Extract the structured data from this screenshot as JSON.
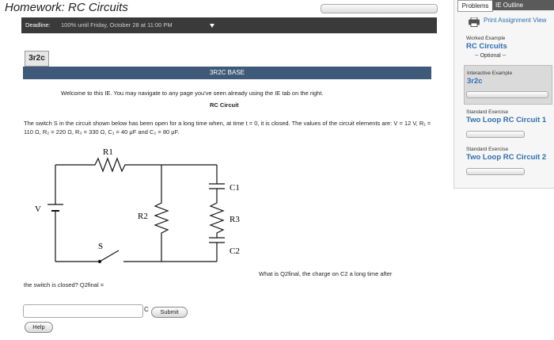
{
  "header": {
    "title": "Homework: RC Circuits",
    "deadline_label": "Deadline:",
    "deadline_value": "100% until Friday, October 28 at 11:00 PM"
  },
  "part": {
    "tab_label": "3r2c",
    "section_title": "3R2C BASE"
  },
  "content": {
    "welcome": "Welcome to this IE. You may navigate to any page you've seen already using the IE tab on the right.",
    "circuit_title": "RC Circuit",
    "problem_text": "The switch S in the circuit shown below has been open for a long time when, at time t = 0, it is closed. The values of the circuit elements are: V = 12 V, R₁ = 110 Ω, R₂ = 220 Ω, R₃ = 330 Ω, C₁ = 40 μF and C₂ = 80 μF.",
    "question_text": "What is Q2final, the charge on C2 a long time after",
    "question_cont": "the switch is closed? Q2final =",
    "answer_value": "",
    "unit": "C",
    "submit_label": "Submit",
    "help_label": "Help"
  },
  "circuit_labels": {
    "r1": "R1",
    "r2": "R2",
    "r3": "R3",
    "c1": "C1",
    "c2": "C2",
    "v": "V",
    "s": "S"
  },
  "sidebar": {
    "tab_problems": "Problems",
    "tab_outline": "IE Outline",
    "print_label": "Print Assignment View",
    "items": [
      {
        "type": "Worked Example",
        "title": "RC Circuits",
        "note": "-- Optional --"
      },
      {
        "type": "Interactive Example",
        "title": "3r2c"
      },
      {
        "type": "Standard Exercise",
        "title": "Two Loop RC Circuit 1"
      },
      {
        "type": "Standard Exercise",
        "title": "Two Loop RC Circuit 2"
      }
    ]
  },
  "colors": {
    "section_bar": "#3f5a78",
    "deadline_bar": "#3a3a3a",
    "link_blue": "#2d6fb0"
  }
}
